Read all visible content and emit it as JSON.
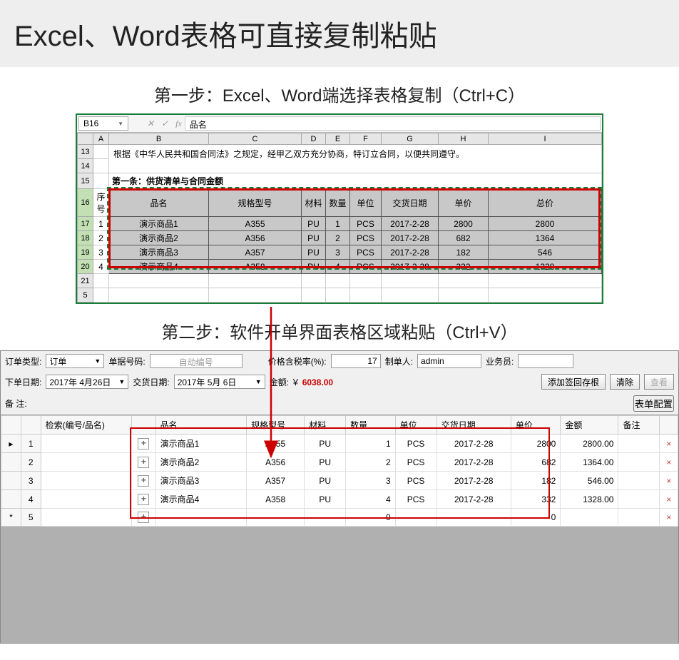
{
  "banner": "Excel、Word表格可直接复制粘贴",
  "step1": "第一步：Excel、Word端选择表格复制（Ctrl+C）",
  "step2": "第二步：软件开单界面表格区域粘贴（Ctrl+V）",
  "excel": {
    "cell_ref": "B16",
    "fx_label": "fx",
    "fx_value": "品名",
    "col_heads": [
      "A",
      "B",
      "C",
      "D",
      "E",
      "F",
      "G",
      "H",
      "I"
    ],
    "row_heads": [
      "13",
      "14",
      "15",
      "16",
      "17",
      "18",
      "19",
      "20",
      "21",
      "5"
    ],
    "intro_text": "根据《中华人民共和国合同法》之规定，经甲乙双方充分协商，特订立合同，以便共同遵守。",
    "section_label": "第一条：供货清单与合同金额",
    "seq_label": "序号",
    "headers": [
      "品名",
      "规格型号",
      "材料",
      "数量",
      "单位",
      "交货日期",
      "单价",
      "总价"
    ],
    "rows": [
      {
        "seq": "1",
        "name": "演示商品1",
        "spec": "A355",
        "mat": "PU",
        "qty": "1",
        "unit": "PCS",
        "date": "2017-2-28",
        "price": "2800",
        "total": "2800"
      },
      {
        "seq": "2",
        "name": "演示商品2",
        "spec": "A356",
        "mat": "PU",
        "qty": "2",
        "unit": "PCS",
        "date": "2017-2-28",
        "price": "682",
        "total": "1364"
      },
      {
        "seq": "3",
        "name": "演示商品3",
        "spec": "A357",
        "mat": "PU",
        "qty": "3",
        "unit": "PCS",
        "date": "2017-2-28",
        "price": "182",
        "total": "546"
      },
      {
        "seq": "4",
        "name": "演示商品4",
        "spec": "A358",
        "mat": "PU",
        "qty": "4",
        "unit": "PCS",
        "date": "2017-2-28",
        "price": "332",
        "total": "1328"
      }
    ]
  },
  "app": {
    "labels": {
      "order_type": "订单类型:",
      "doc_no": "单据号码:",
      "auto_no": "自动编号",
      "tax_rate": "价格含税率(%):",
      "maker": "制单人:",
      "salesman": "业务员:",
      "order_date": "下单日期:",
      "deliver_date": "交货日期:",
      "amount": "金额: ￥",
      "notes": "备    注:"
    },
    "values": {
      "order_type": "订单",
      "tax_rate": "17",
      "maker": "admin",
      "order_date": "2017年 4月26日",
      "deliver_date": "2017年  5月  6日",
      "amount": "6038.00"
    },
    "buttons": {
      "add_sign": "添加签回存根",
      "clear": "清除",
      "view": "查看",
      "config": "表单配置"
    },
    "grid": {
      "headers": {
        "search": "检索(编号/品名)",
        "name": "品名",
        "spec": "规格型号",
        "mat": "材料",
        "qty": "数量",
        "unit": "单位",
        "date": "交货日期",
        "price": "单价",
        "amount": "金额",
        "note": "备注"
      },
      "rows": [
        {
          "n": "1",
          "name": "演示商品1",
          "spec": "A355",
          "mat": "PU",
          "qty": "1",
          "unit": "PCS",
          "date": "2017-2-28",
          "price": "2800",
          "amount": "2800.00"
        },
        {
          "n": "2",
          "name": "演示商品2",
          "spec": "A356",
          "mat": "PU",
          "qty": "2",
          "unit": "PCS",
          "date": "2017-2-28",
          "price": "682",
          "amount": "1364.00"
        },
        {
          "n": "3",
          "name": "演示商品3",
          "spec": "A357",
          "mat": "PU",
          "qty": "3",
          "unit": "PCS",
          "date": "2017-2-28",
          "price": "182",
          "amount": "546.00"
        },
        {
          "n": "4",
          "name": "演示商品4",
          "spec": "A358",
          "mat": "PU",
          "qty": "4",
          "unit": "PCS",
          "date": "2017-2-28",
          "price": "332",
          "amount": "1328.00"
        }
      ],
      "sum_row": {
        "n": "5",
        "qty": "0",
        "price": "0"
      }
    }
  }
}
